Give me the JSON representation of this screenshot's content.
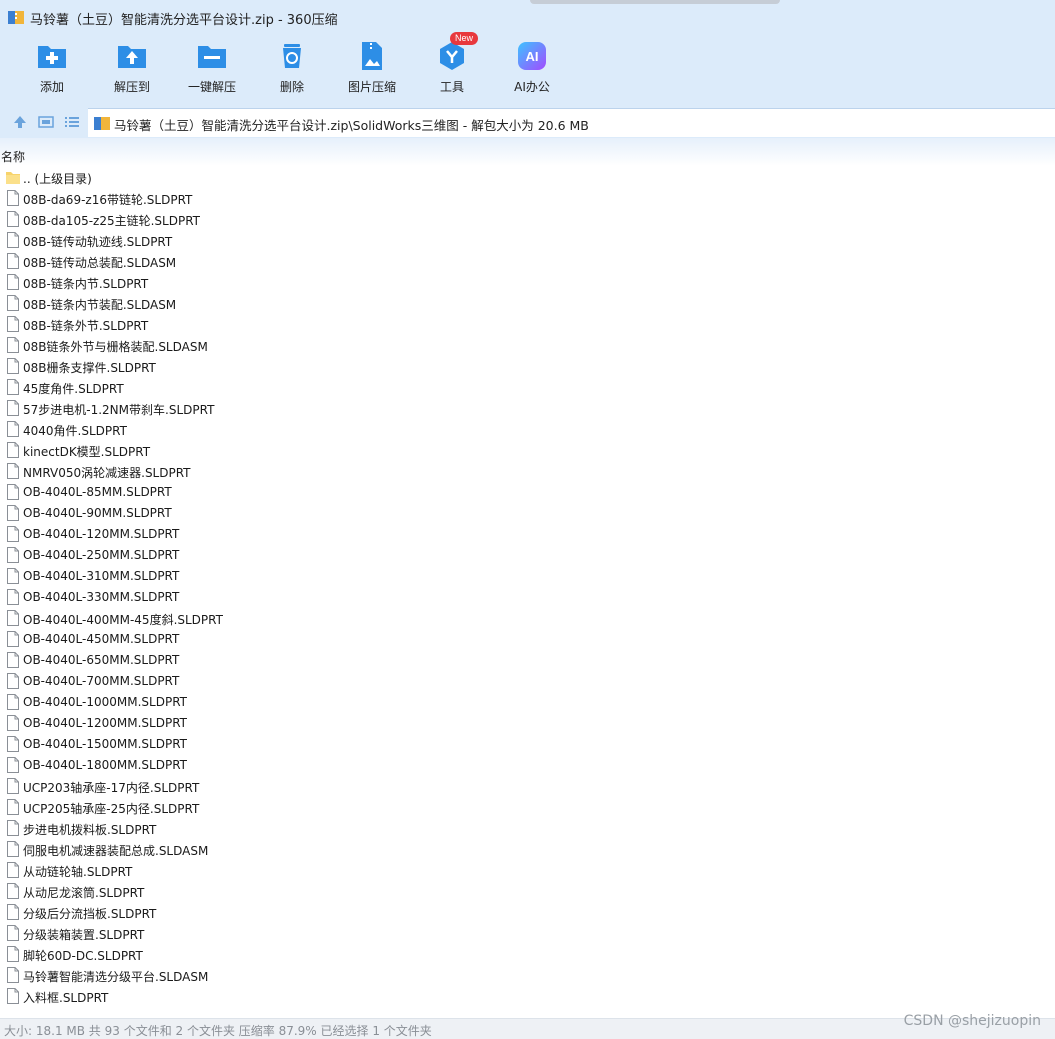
{
  "window": {
    "title": "马铃薯（土豆）智能清洗分选平台设计.zip - 360压缩"
  },
  "toolbar": {
    "tools": [
      {
        "label": "添加",
        "icon": "add-icon",
        "color": "#2d8ee6"
      },
      {
        "label": "解压到",
        "icon": "extract-to-icon",
        "color": "#2d8ee6"
      },
      {
        "label": "一键解压",
        "icon": "one-click-extract-icon",
        "color": "#2d8ee6"
      },
      {
        "label": "删除",
        "icon": "delete-icon",
        "color": "#2d8ee6"
      },
      {
        "label": "图片压缩",
        "icon": "image-compress-icon",
        "color": "#2d8ee6"
      },
      {
        "label": "工具",
        "icon": "tools-icon",
        "color": "#2d8ee6",
        "badge": "New"
      },
      {
        "label": "AI办公",
        "icon": "ai-office-icon",
        "color": "#7b4dff"
      }
    ]
  },
  "address": {
    "path": "马铃薯（土豆）智能清洗分选平台设计.zip\\SolidWorks三维图 - 解包大小为 20.6 MB"
  },
  "columns": {
    "name": "名称"
  },
  "files": [
    {
      "name": ".. (上级目录)",
      "type": "folder"
    },
    {
      "name": "08B-da69-z16带链轮.SLDPRT",
      "type": "file"
    },
    {
      "name": "08B-da105-z25主链轮.SLDPRT",
      "type": "file"
    },
    {
      "name": "08B-链传动轨迹线.SLDPRT",
      "type": "file"
    },
    {
      "name": "08B-链传动总装配.SLDASM",
      "type": "file"
    },
    {
      "name": "08B-链条内节.SLDPRT",
      "type": "file"
    },
    {
      "name": "08B-链条内节装配.SLDASM",
      "type": "file"
    },
    {
      "name": "08B-链条外节.SLDPRT",
      "type": "file"
    },
    {
      "name": "08B链条外节与栅格装配.SLDASM",
      "type": "file"
    },
    {
      "name": "08B栅条支撑件.SLDPRT",
      "type": "file"
    },
    {
      "name": "45度角件.SLDPRT",
      "type": "file"
    },
    {
      "name": "57步进电机-1.2NM带刹车.SLDPRT",
      "type": "file"
    },
    {
      "name": "4040角件.SLDPRT",
      "type": "file"
    },
    {
      "name": "kinectDK模型.SLDPRT",
      "type": "file"
    },
    {
      "name": "NMRV050涡轮减速器.SLDPRT",
      "type": "file"
    },
    {
      "name": "OB-4040L-85MM.SLDPRT",
      "type": "file"
    },
    {
      "name": "OB-4040L-90MM.SLDPRT",
      "type": "file"
    },
    {
      "name": "OB-4040L-120MM.SLDPRT",
      "type": "file"
    },
    {
      "name": "OB-4040L-250MM.SLDPRT",
      "type": "file"
    },
    {
      "name": "OB-4040L-310MM.SLDPRT",
      "type": "file"
    },
    {
      "name": "OB-4040L-330MM.SLDPRT",
      "type": "file"
    },
    {
      "name": "OB-4040L-400MM-45度斜.SLDPRT",
      "type": "file"
    },
    {
      "name": "OB-4040L-450MM.SLDPRT",
      "type": "file"
    },
    {
      "name": "OB-4040L-650MM.SLDPRT",
      "type": "file"
    },
    {
      "name": "OB-4040L-700MM.SLDPRT",
      "type": "file"
    },
    {
      "name": "OB-4040L-1000MM.SLDPRT",
      "type": "file"
    },
    {
      "name": "OB-4040L-1200MM.SLDPRT",
      "type": "file"
    },
    {
      "name": "OB-4040L-1500MM.SLDPRT",
      "type": "file"
    },
    {
      "name": "OB-4040L-1800MM.SLDPRT",
      "type": "file"
    },
    {
      "name": "UCP203轴承座-17内径.SLDPRT",
      "type": "file"
    },
    {
      "name": "UCP205轴承座-25内径.SLDPRT",
      "type": "file"
    },
    {
      "name": "步进电机拨料板.SLDPRT",
      "type": "file"
    },
    {
      "name": "伺服电机减速器装配总成.SLDASM",
      "type": "file"
    },
    {
      "name": "从动链轮轴.SLDPRT",
      "type": "file"
    },
    {
      "name": "从动尼龙滚筒.SLDPRT",
      "type": "file"
    },
    {
      "name": "分级后分流挡板.SLDPRT",
      "type": "file"
    },
    {
      "name": "分级装箱装置.SLDPRT",
      "type": "file"
    },
    {
      "name": "脚轮60D-DC.SLDPRT",
      "type": "file"
    },
    {
      "name": "马铃薯智能清选分级平台.SLDASM",
      "type": "file"
    },
    {
      "name": "入料框.SLDPRT",
      "type": "file"
    }
  ],
  "status": {
    "text": "大小: 18.1 MB 共 93 个文件和 2 个文件夹 压缩率 87.9% 已经选择 1 个文件夹",
    "watermark": "CSDN @shejizuopin"
  }
}
